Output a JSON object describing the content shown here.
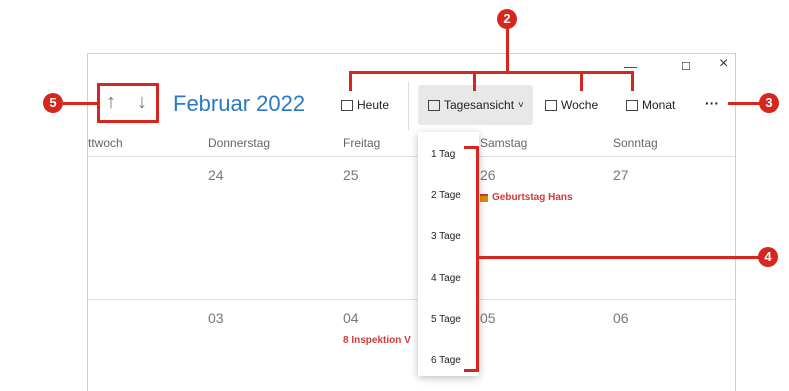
{
  "window": {
    "minimize_glyph": "—",
    "maximize_glyph": "☐",
    "close_glyph": "×"
  },
  "nav": {
    "title": "Februar 2022",
    "up_glyph": "↑",
    "down_glyph": "↓"
  },
  "toolbar": {
    "today": "Heute",
    "dayview": "Tagesansicht",
    "dayview_chevron": "˅",
    "week": "Woche",
    "month": "Monat",
    "more": "···"
  },
  "days": [
    "ttwoch",
    "Donnerstag",
    "Freitag",
    "Samstag",
    "Sonntag"
  ],
  "week1": {
    "thu": "24",
    "fri": "25",
    "sat": "26",
    "sun": "27",
    "sat_event": "Geburtstag Hans"
  },
  "week2": {
    "thu": "03",
    "fri": "04",
    "sat": "05",
    "sun": "06",
    "fri_event": "8 Inspektion V"
  },
  "menu": {
    "items": [
      "1 Tag",
      "2 Tage",
      "3 Tage",
      "4 Tage",
      "5 Tage",
      "6 Tage"
    ]
  },
  "callouts": [
    "2",
    "3",
    "4",
    "5"
  ],
  "colors": {
    "accent_red": "#d6271e",
    "title_blue": "#2b79c2",
    "event_red": "#d03b3b"
  }
}
